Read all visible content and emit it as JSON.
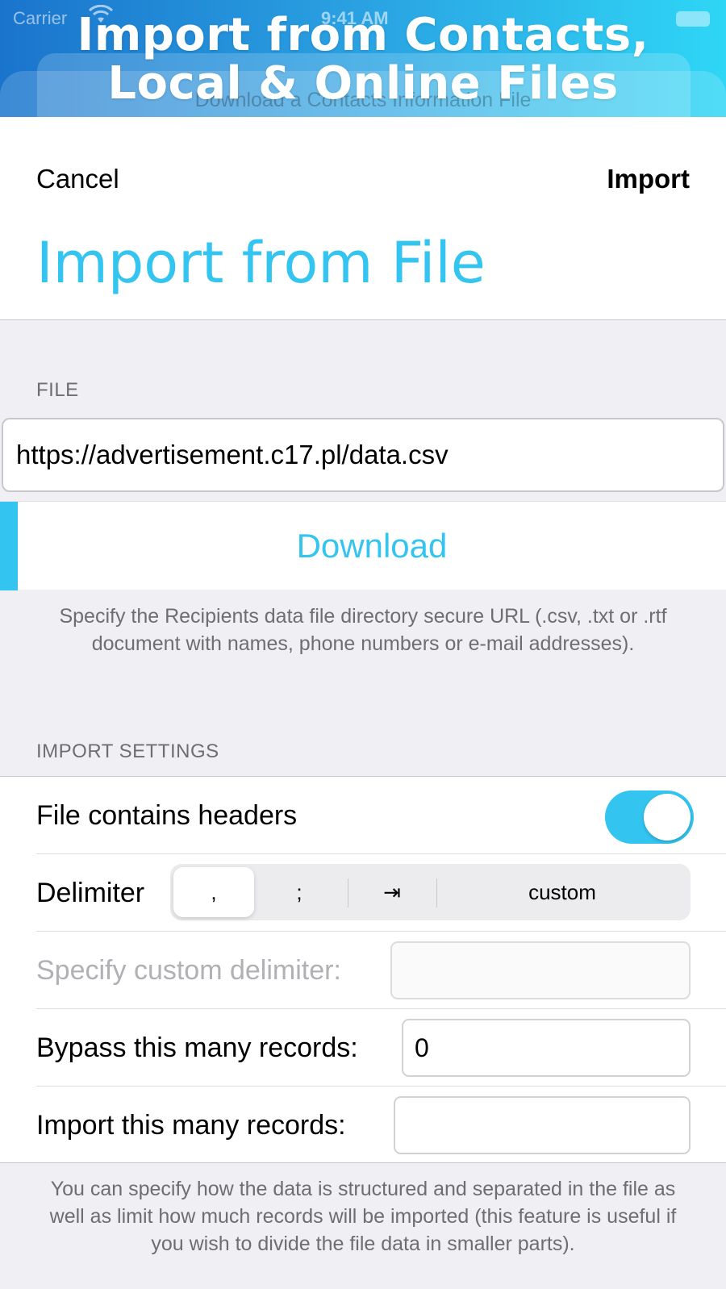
{
  "promo": {
    "title_line1": "Import from Contacts,",
    "title_line2": "Local & Online Files"
  },
  "status_bar": {
    "carrier": "Carrier",
    "time": "9:41 AM"
  },
  "underlying_sheet_title": "Download a Contacts Information File",
  "nav": {
    "cancel_label": "Cancel",
    "import_label": "Import",
    "title": "Import from File"
  },
  "file_section": {
    "header": "FILE",
    "url_value": "https://advertisement.c17.pl/data.csv",
    "download_label": "Download",
    "footer": "Specify the Recipients data file directory secure URL (.csv, .txt or .rtf document with names, phone numbers or e-mail addresses)."
  },
  "settings_section": {
    "header": "IMPORT SETTINGS",
    "headers_label": "File contains headers",
    "headers_on": true,
    "delimiter_label": "Delimiter",
    "delimiter_options": [
      ",",
      ";",
      "⇥",
      "custom"
    ],
    "delimiter_selected": ",",
    "custom_delimiter_label": "Specify custom delimiter:",
    "custom_delimiter_value": "",
    "bypass_label": "Bypass this many records:",
    "bypass_value": "0",
    "import_count_label": "Import this many records:",
    "import_count_value": "",
    "footer": "You can specify how the data is structured and separated in the file as well as limit how much records will be imported (this feature is useful if you wish to divide the file data in smaller parts)."
  },
  "colors": {
    "accent": "#33c5f0",
    "banner_start": "#1a74cc",
    "banner_end": "#2fd6f5",
    "background": "#efeff4"
  }
}
